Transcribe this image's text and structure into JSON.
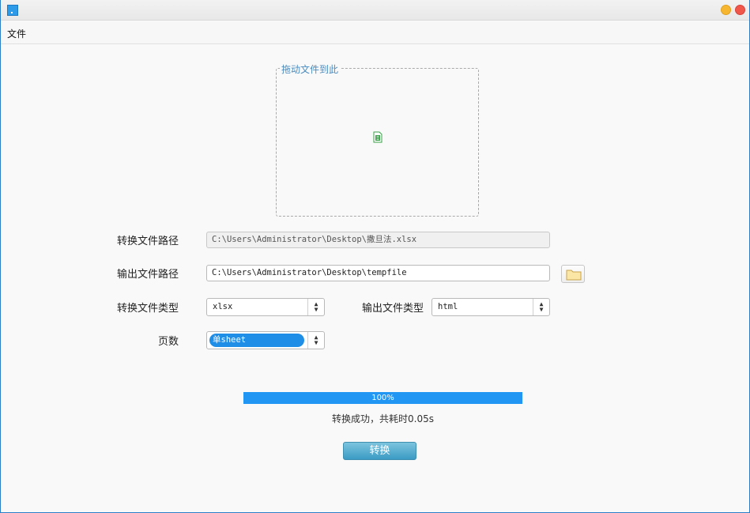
{
  "menubar": {
    "file": "文件"
  },
  "drop_zone": {
    "legend": "拖动文件到此",
    "file_icon": "spreadsheet-file-icon"
  },
  "form": {
    "convert_path_label": "转换文件路径",
    "convert_path_value": "C:\\Users\\Administrator\\Desktop\\撒旦法.xlsx",
    "output_path_label": "输出文件路径",
    "output_path_value": "C:\\Users\\Administrator\\Desktop\\tempfile",
    "convert_type_label": "转换文件类型",
    "convert_type_value": "xlsx",
    "output_type_label": "输出文件类型",
    "output_type_value": "html",
    "pages_label": "页数",
    "pages_value": "单sheet"
  },
  "progress": {
    "percent": 100,
    "text": "100%"
  },
  "status": "转换成功，共耗时0.05s",
  "convert_button": "转换",
  "colors": {
    "accent": "#2196f3",
    "button": "#3b9bc4",
    "close": "#f0564a",
    "minimize": "#f6b62f"
  }
}
